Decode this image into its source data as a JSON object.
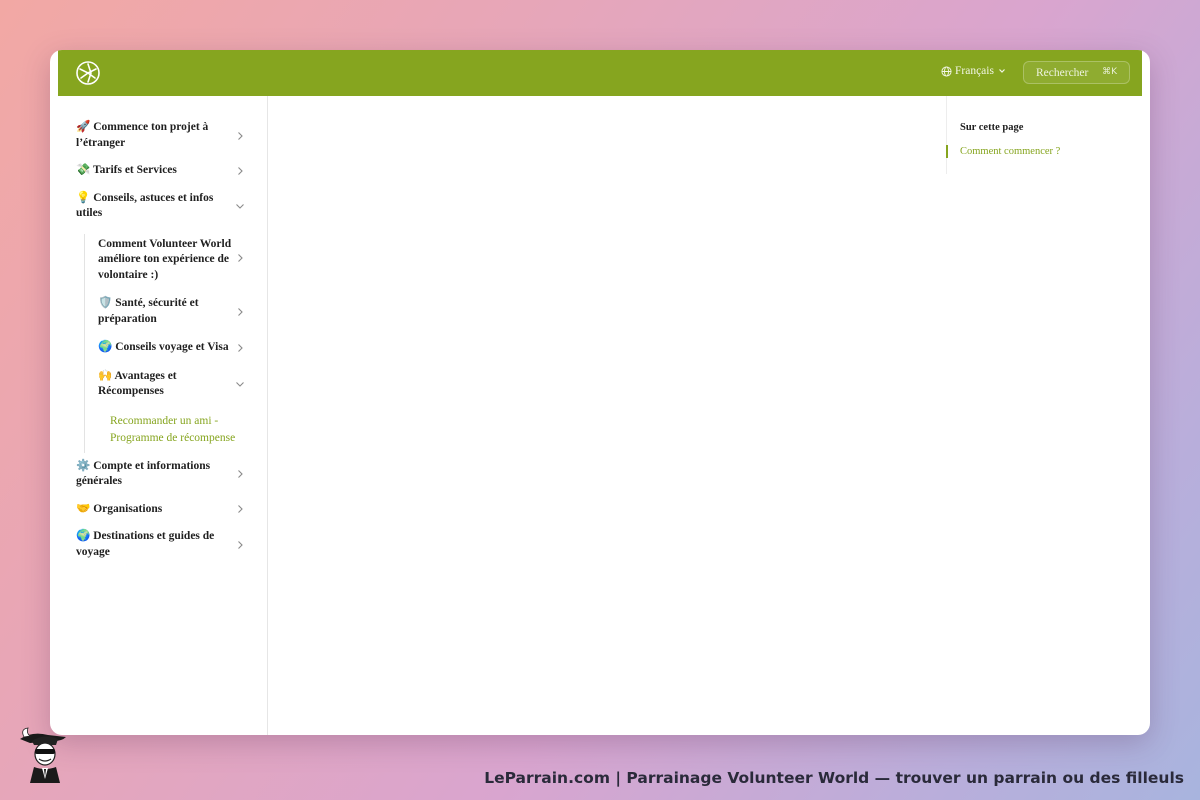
{
  "header": {
    "logo_icon": "volunteer-world-logo",
    "language": "Français",
    "search_label": "Rechercher",
    "search_shortcut": "⌘K",
    "accent_color": "#86a51f"
  },
  "sidebar": {
    "items": [
      {
        "label": "🚀 Commence ton projet à l’étranger",
        "expanded": false
      },
      {
        "label": "💸 Tarifs et Services",
        "expanded": false
      },
      {
        "label": "💡 Conseils, astuces et infos utiles",
        "expanded": true,
        "children": [
          {
            "label": "Comment Volunteer World améliore ton expérience de volontaire :)",
            "expanded": false
          },
          {
            "label": "🛡️ Santé, sécurité et préparation",
            "expanded": false
          },
          {
            "label": "🌍 Conseils voyage et Visa",
            "expanded": false
          },
          {
            "label": "🙌 Avantages et Récompenses",
            "expanded": true,
            "children": [
              {
                "label": "Recommander un ami - Programme de récompense",
                "active": true
              }
            ]
          }
        ]
      },
      {
        "label": "⚙️ Compte et informations générales",
        "expanded": false
      },
      {
        "label": "🤝 Organisations",
        "expanded": false
      },
      {
        "label": "🌍 Destinations et guides de voyage",
        "expanded": false
      }
    ]
  },
  "toc": {
    "title": "Sur cette page",
    "links": [
      "Comment commencer ?"
    ]
  },
  "footer": {
    "caption": "LeParrain.com | Parrainage Volunteer World — trouver un parrain ou des filleuls",
    "mascot_icon": "leparrain-mascot"
  }
}
